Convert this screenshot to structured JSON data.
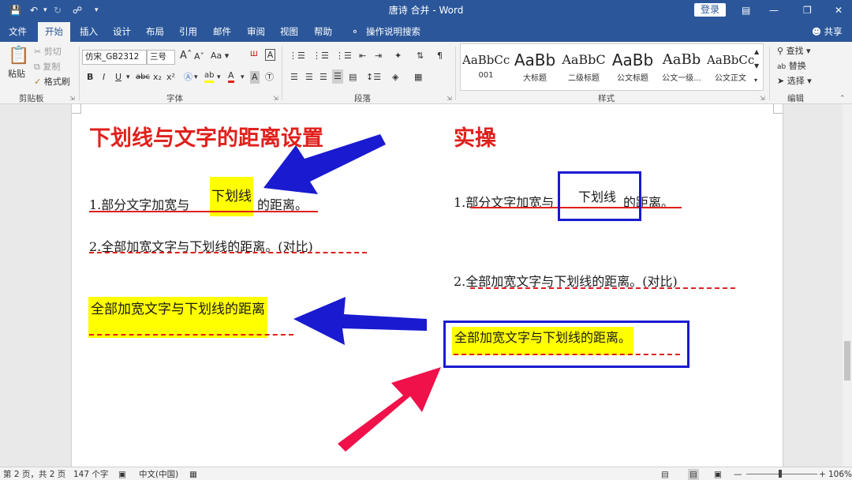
{
  "window": {
    "title": "唐诗 合并 - Word",
    "login": "登录"
  },
  "tabs": [
    "文件",
    "开始",
    "插入",
    "设计",
    "布局",
    "引用",
    "邮件",
    "审阅",
    "视图",
    "帮助"
  ],
  "tell_me": "操作说明搜索",
  "share": "共享",
  "clipboard": {
    "paste": "粘贴",
    "cut": "剪切",
    "copy": "复制",
    "format_painter": "格式刷",
    "label": "剪贴板"
  },
  "font": {
    "name": "仿宋_GB2312",
    "size": "三号",
    "label": "字体",
    "bold": "B",
    "italic": "I",
    "underline": "U",
    "strike": "abc",
    "sub": "x₂",
    "sup": "x²",
    "change_case": "Aa",
    "grow": "A",
    "shrink": "A",
    "font_color": "A",
    "highlight": "ab",
    "char_shade": "A"
  },
  "paragraph": {
    "label": "段落"
  },
  "styles": {
    "label": "样式",
    "items": [
      {
        "preview": "AaBbCc",
        "name": "001"
      },
      {
        "preview": "AaBb",
        "name": "大标题"
      },
      {
        "preview": "AaBbC",
        "name": "二级标题"
      },
      {
        "preview": "AaBb",
        "name": "公文标题"
      },
      {
        "preview": "AaBb",
        "name": "公文一级..."
      },
      {
        "preview": "AaBbCc",
        "name": "公文正文"
      }
    ]
  },
  "editing": {
    "find": "查找",
    "replace": "替换",
    "select": "选择",
    "label": "编辑"
  },
  "document": {
    "left_title": "下划线与文字的距离设置",
    "right_title": "实操",
    "left_line1_a": "1.部分文字加宽与",
    "left_line1_b": "下划线",
    "left_line1_c": "的距离。",
    "left_line2": "2.全部加宽文字与下划线的距离。(对比)",
    "left_line3": "全部加宽文字与下划线的距离",
    "right_line1_a": "1.部分文字加宽与",
    "right_line1_b": "下划线",
    "right_line1_c": "的距离。",
    "right_line2": "2.全部加宽文字与下划线的距离。(对比)",
    "right_line3": "全部加宽文字与下划线的距离。"
  },
  "status": {
    "page": "第 2 页，共 2 页",
    "words": "147 个字",
    "lang": "中文(中国)",
    "zoom": "106%"
  },
  "colors": {
    "word_blue": "#2b579a",
    "red": "#e0201c",
    "highlight": "#ffff00",
    "annot_blue": "#1a1ad1"
  }
}
